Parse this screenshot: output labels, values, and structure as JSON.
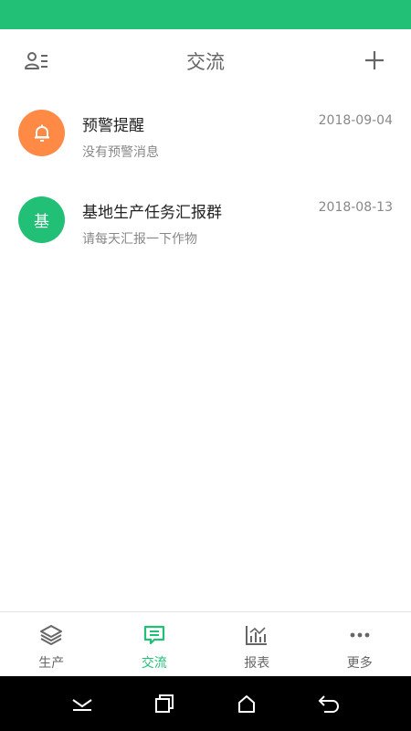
{
  "header": {
    "title": "交流"
  },
  "conversations": [
    {
      "name": "预警提醒",
      "date": "2018-09-04",
      "preview": "没有预警消息",
      "avatar_icon": "bell-icon",
      "avatar_color": "#ff8a45"
    },
    {
      "name": "基地生产任务汇报群",
      "date": "2018-08-13",
      "preview": "请每天汇报一下作物",
      "avatar_text": "基",
      "avatar_color": "#22bf76"
    }
  ],
  "tabs": [
    {
      "label": "生产",
      "icon": "layers-icon",
      "active": false
    },
    {
      "label": "交流",
      "icon": "chat-icon",
      "active": true
    },
    {
      "label": "报表",
      "icon": "chart-icon",
      "active": false
    },
    {
      "label": "更多",
      "icon": "more-icon",
      "active": false
    }
  ],
  "colors": {
    "accent": "#22bf76",
    "alert": "#ff8a45",
    "status_bar": "#22bf76"
  },
  "system_nav": [
    "collapse-icon",
    "recents-icon",
    "home-icon",
    "back-icon"
  ]
}
